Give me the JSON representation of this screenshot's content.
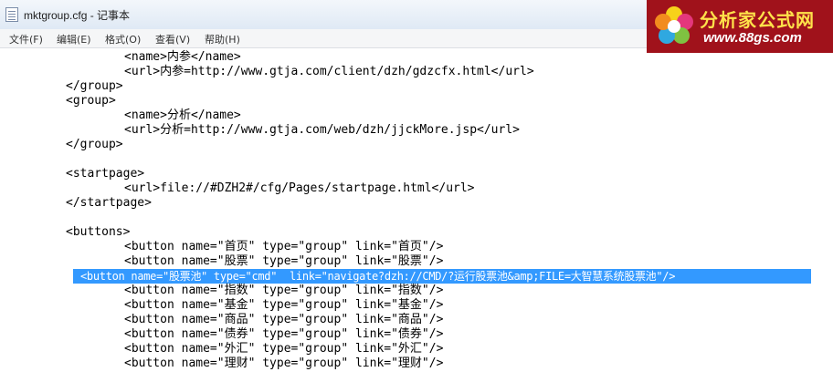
{
  "window": {
    "title": "mktgroup.cfg - 记事本"
  },
  "menu": [
    "文件(F)",
    "编辑(E)",
    "格式(O)",
    "查看(V)",
    "帮助(H)"
  ],
  "editor": {
    "lines": [
      "<name>内参</name>",
      "<url>内参=http://www.gtja.com/client/dzh/gdzcfx.html</url>",
      "</group>",
      "<group>",
      "<name>分析</name>",
      "<url>分析=http://www.gtja.com/web/dzh/jjckMore.jsp</url>",
      "</group>",
      "",
      "<startpage>",
      "<url>file://#DZH2#/cfg/Pages/startpage.html</url>",
      "</startpage>",
      "",
      "<buttons>",
      "<button name=\"首页\" type=\"group\" link=\"首页\"/>",
      "<button name=\"股票\" type=\"group\" link=\"股票\"/>",
      "<button name=\"股票池\" type=\"cmd\"  link=\"navigate?dzh://CMD/?运行股票池&amp;FILE=大智慧系统股票池\"/>",
      "<button name=\"指数\" type=\"group\" link=\"指数\"/>",
      "<button name=\"基金\" type=\"group\" link=\"基金\"/>",
      "<button name=\"商品\" type=\"group\" link=\"商品\"/>",
      "<button name=\"债券\" type=\"group\" link=\"债券\"/>",
      "<button name=\"外汇\" type=\"group\" link=\"外汇\"/>",
      "<button name=\"理财\" type=\"group\" link=\"理财\"/>"
    ]
  },
  "watermark": {
    "name": "分析家公式网",
    "url": "www.88gs.com"
  },
  "colors": {
    "selection": "#3399ff",
    "logo_bg": "#a0121b",
    "logo_text": "#ffe24a"
  }
}
